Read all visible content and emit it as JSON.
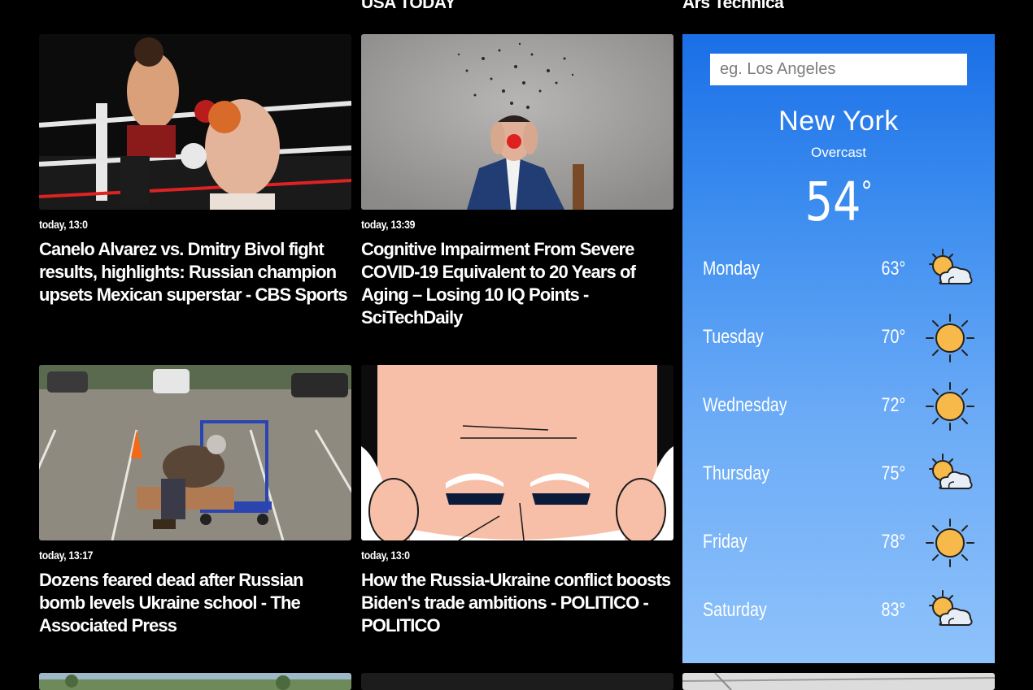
{
  "top_sources": [
    "USA TODAY",
    "Ars Technica"
  ],
  "articles": [
    {
      "time": "today, 13:0",
      "title": "Canelo Alvarez vs. Dmitry Bivol fight results, highlights: Russian champion upsets Mexican superstar - CBS Sports"
    },
    {
      "time": "today, 13:39",
      "title": "Cognitive Impairment From Severe COVID-19 Equivalent to 20 Years of Aging – Losing 10 IQ Points - SciTechDaily"
    },
    {
      "time": "today, 13:17",
      "title": "Dozens feared dead after Russian bomb levels Ukraine school - The Associated Press"
    },
    {
      "time": "today, 13:0",
      "title": "How the Russia-Ukraine conflict boosts Biden's trade ambitions - POLITICO - POLITICO"
    }
  ],
  "weather": {
    "search_placeholder": "eg. Los Angeles",
    "city": "New York",
    "condition": "Overcast",
    "temp": "54",
    "degree": "°",
    "forecast": [
      {
        "day": "Monday",
        "temp": "63°",
        "icon": "partly-cloudy-icon"
      },
      {
        "day": "Tuesday",
        "temp": "70°",
        "icon": "sun-icon"
      },
      {
        "day": "Wednesday",
        "temp": "72°",
        "icon": "sun-icon"
      },
      {
        "day": "Thursday",
        "temp": "75°",
        "icon": "partly-cloudy-icon"
      },
      {
        "day": "Friday",
        "temp": "78°",
        "icon": "sun-icon"
      },
      {
        "day": "Saturday",
        "temp": "83°",
        "icon": "partly-cloudy-icon"
      }
    ]
  },
  "colors": {
    "background": "#000000",
    "weather_top": "#1a6fe6",
    "weather_bottom": "#8ec2fb",
    "sun": "#f6b94a"
  }
}
